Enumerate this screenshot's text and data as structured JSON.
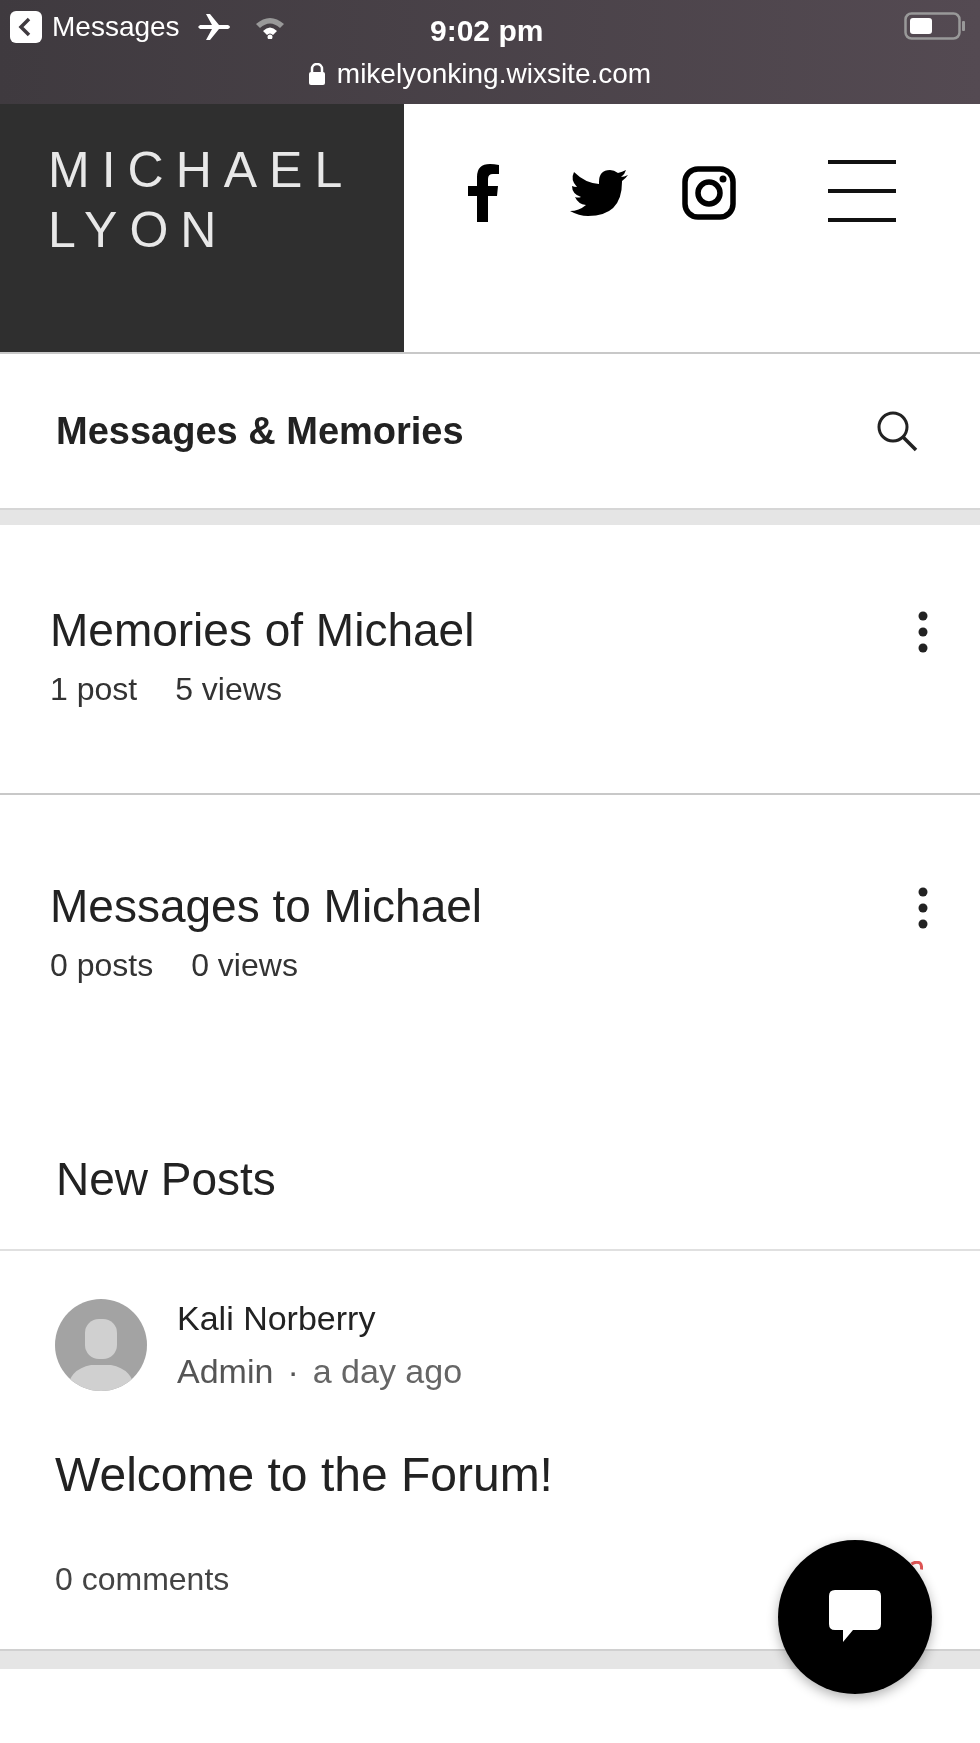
{
  "status_bar": {
    "back_label": "Messages",
    "time": "9:02 pm",
    "url": "mikelyonking.wixsite.com"
  },
  "site_header": {
    "logo_lines": [
      "MICHAEL",
      "LYON"
    ]
  },
  "forum": {
    "title": "Messages & Memories"
  },
  "categories": [
    {
      "title": "Memories of Michael",
      "posts": "1 post",
      "views": "5 views"
    },
    {
      "title": "Messages to Michael",
      "posts": "0 posts",
      "views": "0 views"
    }
  ],
  "section_title": "New Posts",
  "posts": [
    {
      "author": "Kali Norberry",
      "role": "Admin",
      "separator": "·",
      "time": "a day ago",
      "title": "Welcome to the Forum!",
      "comments": "0 comments"
    }
  ]
}
